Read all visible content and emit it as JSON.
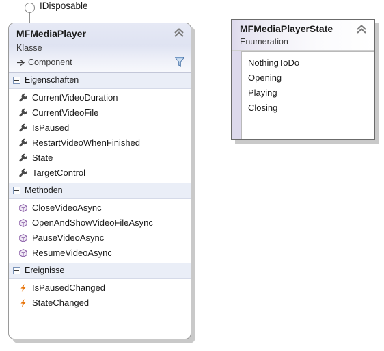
{
  "diagram": {
    "interface_connector": {
      "label": "IDisposable",
      "icon": "lollipop-circle-icon"
    },
    "class_shape": {
      "title": "MFMediaPlayer",
      "stereotype": "Klasse",
      "base_type": "Component",
      "base_icon": "inheritance-arrow-icon",
      "collapse_icon": "chevron-double-up-icon",
      "filter_icon": "funnel-filter-icon",
      "sections": [
        {
          "name": "properties",
          "label": "Eigenschaften",
          "expander_icon": "minus-box-icon",
          "member_icon": "wrench-property-icon",
          "members": [
            "CurrentVideoDuration",
            "CurrentVideoFile",
            "IsPaused",
            "RestartVideoWhenFinished",
            "State",
            "TargetControl"
          ]
        },
        {
          "name": "methods",
          "label": "Methoden",
          "expander_icon": "minus-box-icon",
          "member_icon": "cube-method-icon",
          "members": [
            "CloseVideoAsync",
            "OpenAndShowVideoFileAsync",
            "PauseVideoAsync",
            "ResumeVideoAsync"
          ]
        },
        {
          "name": "events",
          "label": "Ereignisse",
          "expander_icon": "minus-box-icon",
          "member_icon": "lightning-event-icon",
          "members": [
            "IsPausedChanged",
            "StateChanged"
          ]
        }
      ]
    },
    "enum_shape": {
      "title": "MFMediaPlayerState",
      "stereotype": "Enumeration",
      "collapse_icon": "chevron-double-up-icon",
      "members": [
        "NothingToDo",
        "Opening",
        "Playing",
        "Closing"
      ]
    }
  },
  "colors": {
    "class_header_gradient_start": "#e6e9f5",
    "class_header_gradient_end": "#f7f8fc",
    "section_header_bg": "#eaeef7",
    "enum_strip": "#ddd9ec",
    "property_icon": "#4a4a4a",
    "method_icon": "#8b5fa8",
    "event_icon": "#e8760d",
    "shape_border": "#9a9a9a",
    "shadow": "#c9c9c9"
  }
}
